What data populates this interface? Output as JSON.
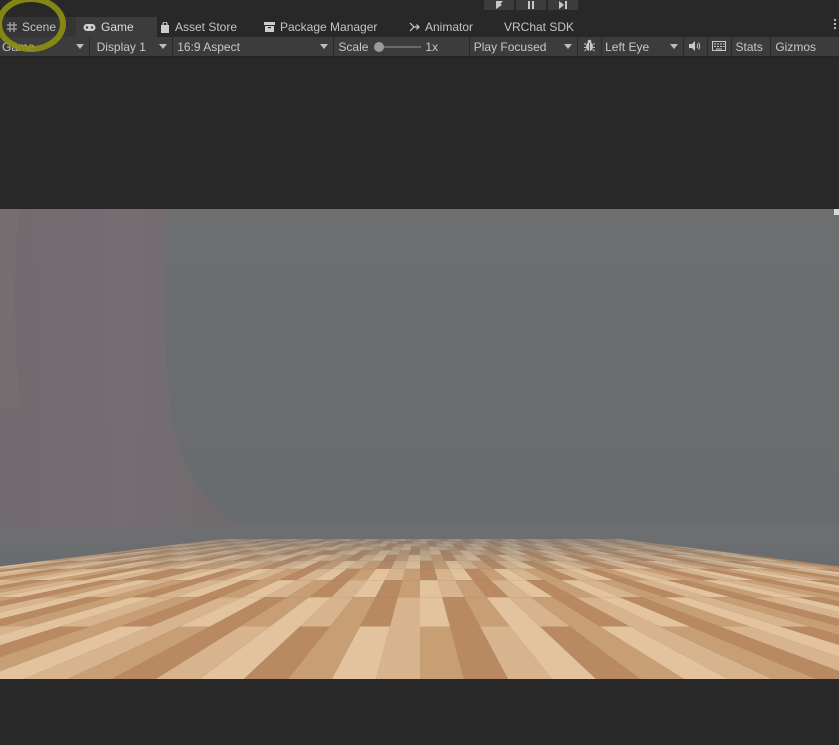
{
  "tabs": [
    {
      "label": "Scene",
      "icon": "grid-icon"
    },
    {
      "label": "Game",
      "icon": "gamepad-icon"
    },
    {
      "label": "Asset Store",
      "icon": "shopping-bag-icon"
    },
    {
      "label": "Package Manager",
      "icon": "package-icon"
    },
    {
      "label": "Animator",
      "icon": "animator-icon"
    },
    {
      "label": "VRChat SDK",
      "icon": ""
    }
  ],
  "play_controls": [
    "play-icon",
    "pause-icon",
    "step-icon"
  ],
  "toolbar": {
    "view_mode": "Game",
    "display": "Display 1",
    "aspect": "16:9 Aspect",
    "scale_label": "Scale",
    "scale_value": "1x",
    "scale_level": 0,
    "play_mode": "Play Focused",
    "eye": "Left Eye",
    "stats": "Stats",
    "gizmos": "Gizmos"
  },
  "colors": {
    "editor_bg": "#282828",
    "toolbar_bg": "#3c3c3c",
    "sky": "#6b6e70",
    "highlight_ring": "#8f8f12"
  }
}
